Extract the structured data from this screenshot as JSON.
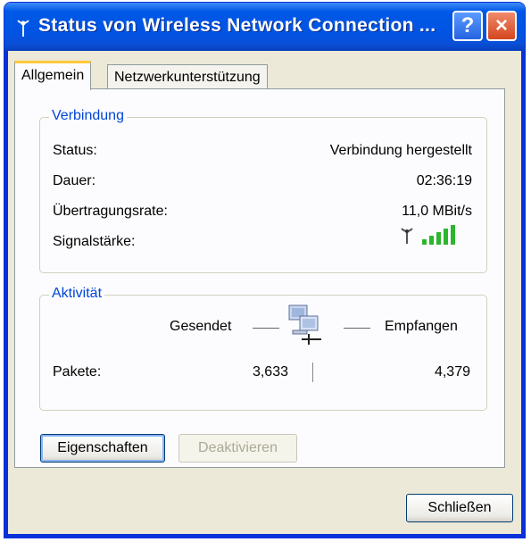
{
  "window": {
    "title": "Status von Wireless Network Connection ...",
    "help_symbol": "?",
    "close_symbol": "×"
  },
  "tabs": [
    {
      "label": "Allgemein",
      "active": true
    },
    {
      "label": "Netzwerkunterstützung",
      "active": false
    }
  ],
  "connection": {
    "group_title": "Verbindung",
    "rows": [
      {
        "label": "Status:",
        "value": "Verbindung hergestellt"
      },
      {
        "label": "Dauer:",
        "value": "02:36:19"
      },
      {
        "label": "Übertragungsrate:",
        "value": "11,0 MBit/s"
      },
      {
        "label": "Signalstärke:",
        "value": ""
      }
    ],
    "signal_bars_filled": 5,
    "signal_bars_total": 5
  },
  "activity": {
    "group_title": "Aktivität",
    "sent_label": "Gesendet",
    "received_label": "Empfangen",
    "packets_label": "Pakete:",
    "packets_sent": "3,633",
    "packets_received": "4,379"
  },
  "buttons": {
    "properties": "Eigenschaften",
    "deactivate": "Deaktivieren",
    "close": "Schließen"
  },
  "colors": {
    "titlebar": "#0054e3",
    "group_title": "#0046d5",
    "signal": "#2db52d",
    "tab_highlight": "#ffc83c"
  }
}
